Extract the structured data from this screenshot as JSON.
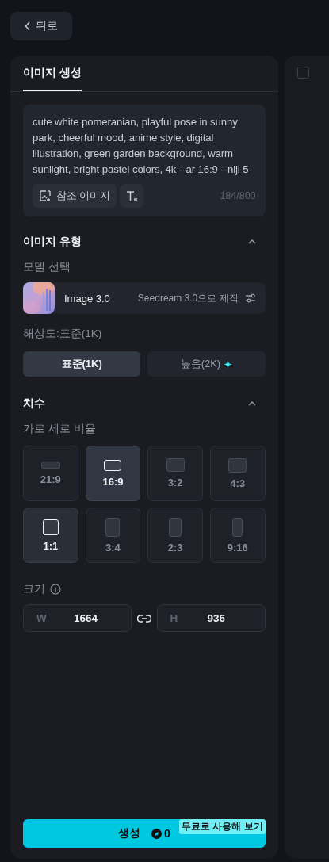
{
  "back_button": {
    "label": "뒤로"
  },
  "tabs": [
    {
      "label": "이미지 생성",
      "selected": true
    }
  ],
  "prompt": {
    "value": "cute white pomeranian, playful pose in sunny park, cheerful mood, anime style, digital illustration, green garden background, warm sunlight, bright pastel colors, 4k --ar 16:9 --niji 5",
    "reference_button": "참조 이미지",
    "counter": "184/800"
  },
  "image_type": {
    "title": "이미지 유형",
    "expanded": true,
    "model_label": "모델 선택",
    "model": {
      "name": "Image 3.0",
      "provider": "Seedream 3.0으로 제작"
    },
    "resolution_label": "해상도:표준(1K)",
    "resolutions": [
      {
        "label": "표준(1K)",
        "selected": true,
        "premium": false
      },
      {
        "label": "높음(2K)",
        "selected": false,
        "premium": true
      }
    ]
  },
  "dimensions": {
    "title": "치수",
    "expanded": true,
    "ratio_label": "가로 세로 비율",
    "ratios": [
      {
        "label": "21:9",
        "kind": "ultrawide",
        "selected": false,
        "hovered": false
      },
      {
        "label": "16:9",
        "kind": "wide",
        "selected": true,
        "hovered": false
      },
      {
        "label": "3:2",
        "selected": false,
        "hovered": false
      },
      {
        "label": "4:3",
        "kind": "classic",
        "selected": false,
        "hovered": false
      },
      {
        "label": "1:1",
        "kind": "square",
        "selected": false,
        "hovered": true
      },
      {
        "label": "3:4",
        "kind": "classic-tall",
        "selected": false,
        "hovered": false
      },
      {
        "label": "2:3",
        "kind": "photo-tall",
        "selected": false,
        "hovered": false
      },
      {
        "label": "9:16",
        "kind": "wide-tall",
        "selected": false,
        "hovered": false
      }
    ],
    "size_label": "크기",
    "width": {
      "prefix": "W",
      "value": "1664"
    },
    "height": {
      "prefix": "H",
      "value": "936"
    }
  },
  "generate": {
    "label": "생성",
    "cost": "0",
    "promo": "무료로 사용해 보기"
  },
  "side_panel": {
    "checked": false
  }
}
